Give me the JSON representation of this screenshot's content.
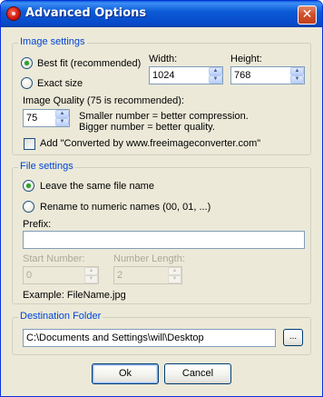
{
  "window": {
    "title": "Advanced Options",
    "close_glyph": "✕"
  },
  "image_settings": {
    "legend": "Image settings",
    "best_fit_label": "Best fit (recommended)",
    "best_fit_checked": true,
    "exact_size_label": "Exact size",
    "exact_size_checked": false,
    "width_label": "Width:",
    "width_value": "1024",
    "height_label": "Height:",
    "height_value": "768",
    "quality_label": "Image Quality (75 is recommended):",
    "quality_value": "75",
    "quality_hint_1": "Smaller number = better compression.",
    "quality_hint_2": "Bigger number = better quality.",
    "add_credit_label": "Add \"Converted by www.freeimageconverter.com\"",
    "add_credit_checked": false
  },
  "file_settings": {
    "legend": "File settings",
    "same_name_label": "Leave the same file name",
    "same_name_checked": true,
    "numeric_label": "Rename to numeric names (00, 01, ...)",
    "numeric_checked": false,
    "prefix_label": "Prefix:",
    "prefix_value": "",
    "start_number_label": "Start Number:",
    "start_number_value": "0",
    "number_length_label": "Number Length:",
    "number_length_value": "2",
    "example_text": "Example: FileName.jpg"
  },
  "destination": {
    "legend": "Destination Folder",
    "path": "C:\\Documents and Settings\\will\\Desktop",
    "browse_label": "..."
  },
  "buttons": {
    "ok": "Ok",
    "cancel": "Cancel"
  },
  "icons": {
    "app": "red-circle-app-icon",
    "spin_up": "▲",
    "spin_down": "▼"
  }
}
